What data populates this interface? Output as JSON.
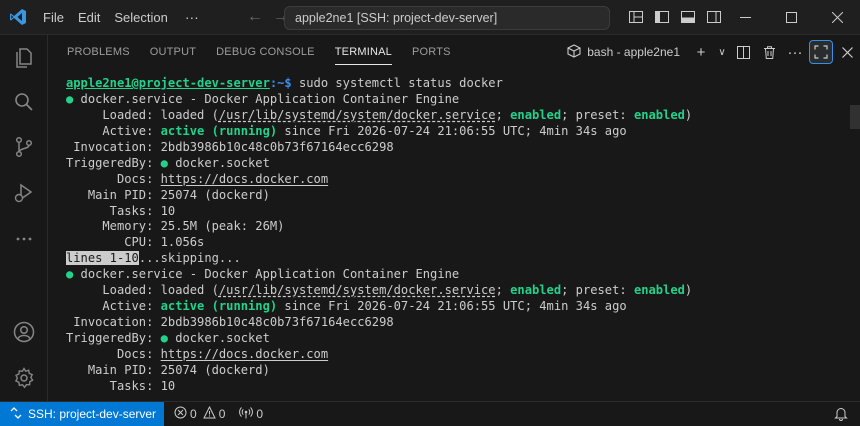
{
  "titlebar": {
    "menu": [
      "File",
      "Edit",
      "Selection"
    ],
    "more_label": "···",
    "command_center": "apple2ne1 [SSH: project-dev-server]"
  },
  "colors": {
    "accent": "#0078d4",
    "terminal_green": "#23d18b",
    "prompt_blue": "#3b8eea",
    "background": "#181818"
  },
  "activity_icons": [
    "explorer-icon",
    "search-icon",
    "source-control-icon",
    "run-debug-icon",
    "more-icon",
    "account-icon",
    "settings-gear-icon"
  ],
  "panel": {
    "tabs": [
      "PROBLEMS",
      "OUTPUT",
      "DEBUG CONSOLE",
      "TERMINAL",
      "PORTS"
    ],
    "active_tab": "TERMINAL",
    "terminal_name": "bash - apple2ne1",
    "new_terminal_label": "+",
    "dropdown_label": "∨"
  },
  "terminal": {
    "prompt_user": "apple2ne1@project-dev-server",
    "prompt_path": ":~$",
    "command": " sudo systemctl status docker",
    "bullet": "●",
    "service_line": " docker.service - Docker Application Container Engine",
    "loaded_label": "     Loaded: ",
    "loaded_pre": "loaded (",
    "loaded_path": "/usr/lib/systemd/system/docker.service",
    "loaded_sep1": "; ",
    "enabled_1": "enabled",
    "loaded_sep2": "; preset: ",
    "enabled_2": "enabled",
    "loaded_end": ")",
    "active_label": "     Active: ",
    "active_state": "active (running)",
    "active_rest": " since Fri 2026-07-24 21:06:55 UTC; 4min 34s ago",
    "invocation": " Invocation: 2bdb3986b10c48c0b73f67164ecc6298",
    "triggered_label": "TriggeredBy: ",
    "triggered_val": " docker.socket",
    "docs_label": "       Docs: ",
    "docs_url": "https://docs.docker.com",
    "main_pid": "   Main PID: 25074 (dockerd)",
    "tasks": "      Tasks: 10",
    "memory": "     Memory: 25.5M (peak: 26M)",
    "cpu": "        CPU: 1.056s",
    "pager_highlight": "lines 1-10",
    "pager_rest": "...skipping..."
  },
  "statusbar": {
    "remote_label": "SSH: project-dev-server",
    "errors": "0",
    "warnings": "0",
    "ports": "0"
  }
}
